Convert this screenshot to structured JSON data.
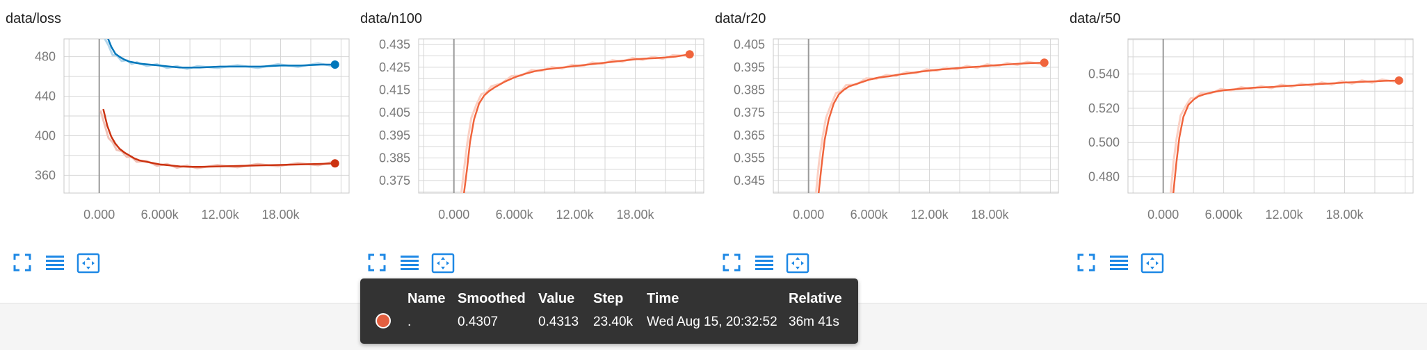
{
  "colors": {
    "series_blue": "#0077bb",
    "series_red": "#cc3311",
    "series_orange": "#f0643c",
    "grid": "#d6d6d6",
    "axis_text": "#7a7a7a",
    "toolbar_icon": "#1e88e5",
    "tooltip_bg": "#333333",
    "tooltip_swatch": "#e35f40"
  },
  "toolbar": {
    "icons": [
      "fullscreen-icon",
      "list-icon",
      "fit-domain-icon"
    ]
  },
  "tooltip": {
    "headers": {
      "name": "Name",
      "smoothed": "Smoothed",
      "value": "Value",
      "step": "Step",
      "time": "Time",
      "relative": "Relative"
    },
    "row": {
      "name": ".",
      "smoothed": "0.4307",
      "value": "0.4313",
      "step": "23.40k",
      "time": "Wed Aug 15, 20:32:52",
      "relative": "36m 41s"
    }
  },
  "chart_data": [
    {
      "type": "line",
      "title": "data/loss",
      "xlim": [
        -3500,
        24800
      ],
      "ylim": [
        342,
        498
      ],
      "x_ticks": [
        0,
        6000,
        12000,
        18000
      ],
      "x_tick_labels": [
        "0.000",
        "6.000k",
        "12.00k",
        "18.00k"
      ],
      "y_ticks": [
        360,
        400,
        440,
        480
      ],
      "y_tick_labels": [
        "360",
        "400",
        "440",
        "480"
      ],
      "grid": true,
      "series": [
        {
          "color": "#0077bb",
          "x": [
            800,
            1200,
            1600,
            2000,
            2500,
            3000,
            3500,
            4000,
            5000,
            6000,
            7000,
            8000,
            9000,
            10000,
            12000,
            14000,
            16000,
            18000,
            20000,
            22000,
            23400
          ],
          "y": [
            500,
            490,
            483,
            480,
            477,
            475,
            474,
            473,
            472,
            471,
            470,
            469,
            469,
            469,
            470,
            470,
            470,
            471,
            471,
            472,
            472
          ]
        },
        {
          "color": "#cc3311",
          "x": [
            400,
            800,
            1200,
            1600,
            2000,
            2500,
            3000,
            3500,
            4000,
            5000,
            6000,
            7000,
            8000,
            9000,
            10000,
            12000,
            14000,
            16000,
            18000,
            20000,
            22000,
            23400
          ],
          "y": [
            427,
            410,
            399,
            392,
            387,
            383,
            380,
            377,
            375,
            373,
            371,
            370,
            369,
            368.5,
            368.5,
            369,
            369.5,
            370,
            370.5,
            371,
            371.5,
            372
          ]
        }
      ]
    },
    {
      "type": "line",
      "title": "data/n100",
      "xlim": [
        -3500,
        24800
      ],
      "ylim": [
        0.3695,
        0.4375
      ],
      "x_ticks": [
        0,
        6000,
        12000,
        18000
      ],
      "x_tick_labels": [
        "0.000",
        "6.000k",
        "12.00k",
        "18.00k"
      ],
      "y_ticks": [
        0.375,
        0.385,
        0.395,
        0.405,
        0.415,
        0.425,
        0.435
      ],
      "y_tick_labels": [
        "0.375",
        "0.385",
        "0.395",
        "0.405",
        "0.415",
        "0.425",
        "0.435"
      ],
      "grid": true,
      "series": [
        {
          "color": "#f0643c",
          "x": [
            1000,
            1300,
            1600,
            2000,
            2500,
            3000,
            3500,
            4000,
            5000,
            6000,
            7000,
            8000,
            9000,
            10000,
            11000,
            12000,
            13000,
            14000,
            15000,
            16000,
            17000,
            18000,
            19000,
            20000,
            21000,
            22000,
            23400
          ],
          "y": [
            0.3695,
            0.38,
            0.392,
            0.402,
            0.409,
            0.4125,
            0.4145,
            0.416,
            0.4185,
            0.4205,
            0.422,
            0.4232,
            0.424,
            0.4245,
            0.425,
            0.4255,
            0.426,
            0.4265,
            0.427,
            0.4275,
            0.428,
            0.4285,
            0.4288,
            0.429,
            0.4293,
            0.4297,
            0.4307
          ]
        }
      ]
    },
    {
      "type": "line",
      "title": "data/r20",
      "xlim": [
        -3500,
        24800
      ],
      "ylim": [
        0.3395,
        0.4075
      ],
      "x_ticks": [
        0,
        6000,
        12000,
        18000
      ],
      "x_tick_labels": [
        "0.000",
        "6.000k",
        "12.00k",
        "18.00k"
      ],
      "y_ticks": [
        0.345,
        0.355,
        0.365,
        0.375,
        0.385,
        0.395,
        0.405
      ],
      "y_tick_labels": [
        "0.345",
        "0.355",
        "0.365",
        "0.375",
        "0.385",
        "0.395",
        "0.405"
      ],
      "grid": true,
      "series": [
        {
          "color": "#f0643c",
          "x": [
            1000,
            1300,
            1600,
            2000,
            2500,
            3000,
            3500,
            4000,
            5000,
            6000,
            7000,
            8000,
            9000,
            10000,
            11000,
            12000,
            13000,
            14000,
            15000,
            16000,
            17000,
            18000,
            19000,
            20000,
            21000,
            22000,
            23400
          ],
          "y": [
            0.3395,
            0.352,
            0.363,
            0.372,
            0.379,
            0.383,
            0.385,
            0.3865,
            0.388,
            0.3895,
            0.3905,
            0.391,
            0.3918,
            0.3923,
            0.393,
            0.3935,
            0.394,
            0.3943,
            0.3947,
            0.395,
            0.3953,
            0.3957,
            0.396,
            0.3963,
            0.3966,
            0.3968,
            0.397
          ]
        }
      ]
    },
    {
      "type": "line",
      "title": "data/r50",
      "xlim": [
        -3500,
        24800
      ],
      "ylim": [
        0.4705,
        0.5605
      ],
      "x_ticks": [
        0,
        6000,
        12000,
        18000
      ],
      "x_tick_labels": [
        "0.000",
        "6.000k",
        "12.00k",
        "18.00k"
      ],
      "y_ticks": [
        0.48,
        0.5,
        0.52,
        0.54
      ],
      "y_tick_labels": [
        "0.480",
        "0.500",
        "0.520",
        "0.540"
      ],
      "grid": true,
      "series": [
        {
          "color": "#f0643c",
          "x": [
            1000,
            1300,
            1600,
            2000,
            2500,
            3000,
            3500,
            4000,
            5000,
            6000,
            7000,
            8000,
            9000,
            10000,
            11000,
            12000,
            13000,
            14000,
            15000,
            16000,
            17000,
            18000,
            19000,
            20000,
            21000,
            22000,
            23400
          ],
          "y": [
            0.4705,
            0.488,
            0.503,
            0.515,
            0.522,
            0.525,
            0.527,
            0.528,
            0.5295,
            0.5305,
            0.531,
            0.5315,
            0.532,
            0.5322,
            0.5325,
            0.533,
            0.5333,
            0.5336,
            0.534,
            0.5343,
            0.5346,
            0.535,
            0.5352,
            0.5355,
            0.5357,
            0.536,
            0.5362
          ]
        }
      ]
    }
  ]
}
